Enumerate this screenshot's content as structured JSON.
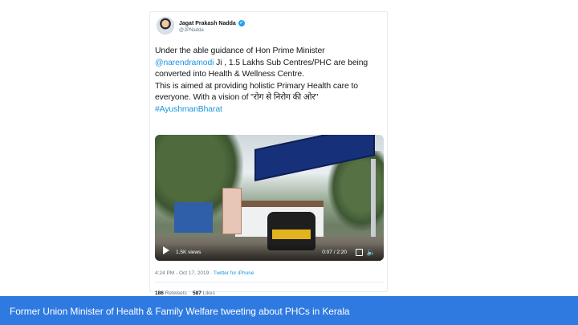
{
  "tweet": {
    "display_name": "Jagat Prakash Nadda",
    "handle": "@JPNadda",
    "verified_icon": "verified-check-icon",
    "text": {
      "line1": "Under the able guidance of Hon Prime Minister",
      "mention": "@narendramodi",
      "line2_rest": " Ji , 1.5 Lakhs Sub Centres/PHC are being",
      "line3": "converted into Health & Wellness Centre.",
      "line4": "This is aimed at providing holistic Primary Health care to",
      "line5": "everyone. With a vision of \"रोग से निरोग की ओर\"",
      "hashtag": "#AyushmanBharat"
    },
    "video": {
      "views": "1.5K views",
      "timecode": "0:07 / 2:20",
      "play_icon": "play-icon",
      "fullscreen_icon": "fullscreen-icon",
      "volume_icon": "volume-icon"
    },
    "meta": {
      "time_date": "4:24 PM - Oct 17, 2019 · ",
      "source": "Twitter for iPhone"
    },
    "stats": {
      "retweets_count": "186",
      "retweets_label": " Retweets",
      "likes_count": "587",
      "likes_label": " Likes"
    }
  },
  "caption": "Former Union Minister of Health & Family Welfare tweeting about PHCs in Kerala",
  "colors": {
    "caption_bar": "#2f7ae0",
    "link": "#1b95e0",
    "verified": "#1da1f2"
  }
}
